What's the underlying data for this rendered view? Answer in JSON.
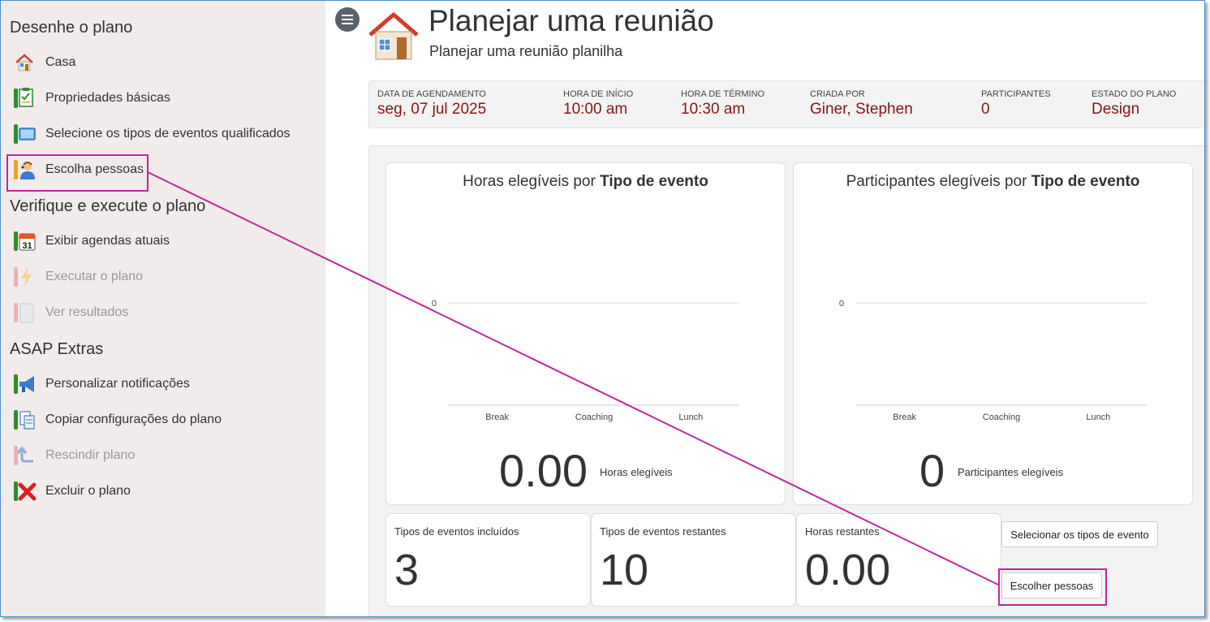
{
  "sidebar": {
    "section1": "Desenhe o plano",
    "section2": "Verifique e execute o plano",
    "section3": "ASAP Extras",
    "items": [
      {
        "label": "Casa",
        "icon": "home-icon"
      },
      {
        "label": "Propriedades básicas",
        "icon": "checklist-icon"
      },
      {
        "label": "Selecione os tipos de eventos qualificados",
        "icon": "screen-icon"
      },
      {
        "label": "Escolha pessoas",
        "icon": "person-icon"
      },
      {
        "label": "Exibir agendas atuais",
        "icon": "calendar-icon"
      },
      {
        "label": "Executar o plano",
        "icon": "lightning-icon"
      },
      {
        "label": "Ver resultados",
        "icon": "document-icon"
      },
      {
        "label": "Personalizar notificações",
        "icon": "megaphone-icon"
      },
      {
        "label": "Copiar configurações do plano",
        "icon": "copy-icon"
      },
      {
        "label": "Rescindir plano",
        "icon": "undo-icon"
      },
      {
        "label": "Excluir o plano",
        "icon": "delete-icon"
      }
    ],
    "calendar_day": "31"
  },
  "header": {
    "title": "Planejar uma reunião",
    "subtitle": "Planejar uma reunião planilha"
  },
  "info": [
    {
      "label": "Data de agendamento",
      "value": "seg, 07 jul 2025"
    },
    {
      "label": "Hora de início",
      "value": "10:00 am"
    },
    {
      "label": "Hora de término",
      "value": "10:30 am"
    },
    {
      "label": "Criada por",
      "value": "Giner, Stephen"
    },
    {
      "label": "Participantes",
      "value": "0"
    },
    {
      "label": "Estado do plano",
      "value": "Design"
    }
  ],
  "chart_data": [
    {
      "type": "bar",
      "title": "Horas elegíveis por Tipo de evento",
      "title_plain": "Horas elegíveis por ",
      "title_bold": "Tipo de evento",
      "categories": [
        "Break",
        "Coaching",
        "Lunch"
      ],
      "values": [
        0,
        0,
        0
      ],
      "y_ticks": [
        "0"
      ]
    },
    {
      "type": "bar",
      "title": "Participantes elegíveis por Tipo de evento",
      "title_plain": "Participantes elegíveis por ",
      "title_bold": "Tipo de evento",
      "categories": [
        "Break",
        "Coaching",
        "Lunch"
      ],
      "values": [
        0,
        0,
        0
      ],
      "y_ticks": [
        "0"
      ]
    }
  ],
  "totals": {
    "hours_value": "0.00",
    "hours_label": "Horas elegíveis",
    "participants_value": "0",
    "participants_label": "Participantes elegíveis"
  },
  "stats": [
    {
      "label": "Tipos de eventos incluídos",
      "value": "3"
    },
    {
      "label": "Tipos de eventos restantes",
      "value": "10"
    },
    {
      "label": "Horas restantes",
      "value": "0.00"
    }
  ],
  "buttons": {
    "select_event_types": "Selecionar os tipos de evento",
    "choose_people": "Escolher pessoas"
  },
  "colors": {
    "accent_value": "#8b1414",
    "highlight": "#c0279a",
    "sidebar_bg": "#f1ebeb",
    "tab_green": "#2e8b2e",
    "tab_red": "#e07070",
    "tab_orange": "#f0a020"
  }
}
